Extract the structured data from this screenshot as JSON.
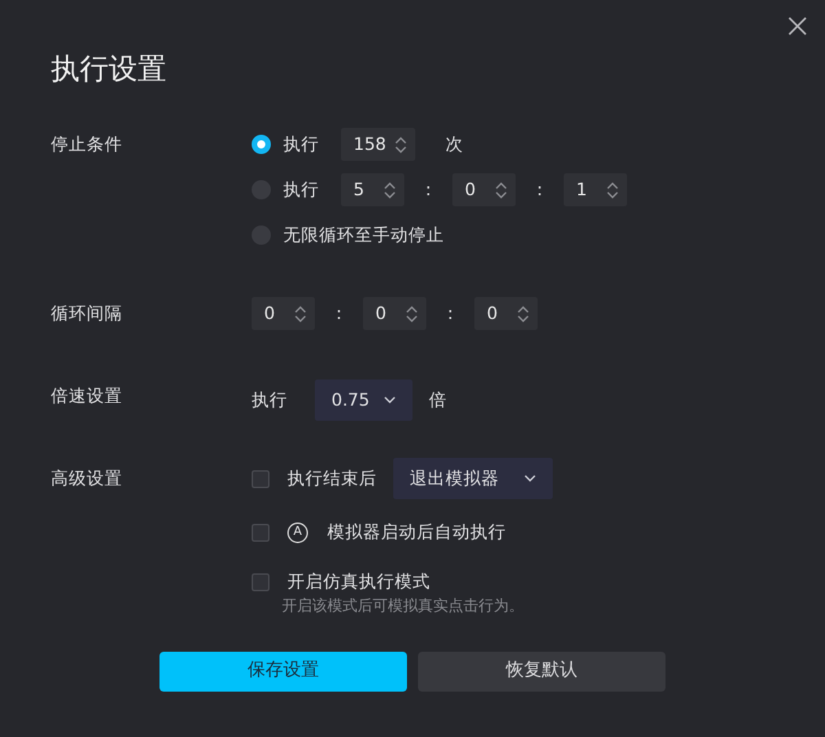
{
  "title": "执行设置",
  "stop_condition": {
    "label": "停止条件",
    "options": [
      {
        "kind": "count",
        "selected": true,
        "label": "执行",
        "value": "158",
        "unit": "次"
      },
      {
        "kind": "duration",
        "selected": false,
        "label": "执行",
        "fields": [
          "5",
          "0",
          "1"
        ],
        "separators": [
          ":",
          ":"
        ]
      },
      {
        "kind": "plain",
        "selected": false,
        "label": "无限循环至手动停止"
      }
    ]
  },
  "loop_interval": {
    "label": "循环间隔",
    "fields": [
      "0",
      "0",
      "0"
    ],
    "separators": [
      ":",
      ":"
    ]
  },
  "speed": {
    "label": "倍速设置",
    "prefix": "执行",
    "value": "0.75",
    "unit": "倍"
  },
  "advanced": {
    "label": "高级设置",
    "options": [
      {
        "kind": "select",
        "checked": false,
        "label": "执行结束后",
        "value": "退出模拟器"
      },
      {
        "kind": "badge",
        "checked": false,
        "badge": "A",
        "label": "模拟器启动后自动执行"
      },
      {
        "kind": "hint",
        "checked": false,
        "label": "开启仿真执行模式",
        "hint": "开启该模式后可模拟真实点击行为。"
      }
    ]
  },
  "buttons": [
    {
      "kind": "primary",
      "label": "保存设置"
    },
    {
      "kind": "secondary",
      "label": "恢复默认"
    }
  ]
}
